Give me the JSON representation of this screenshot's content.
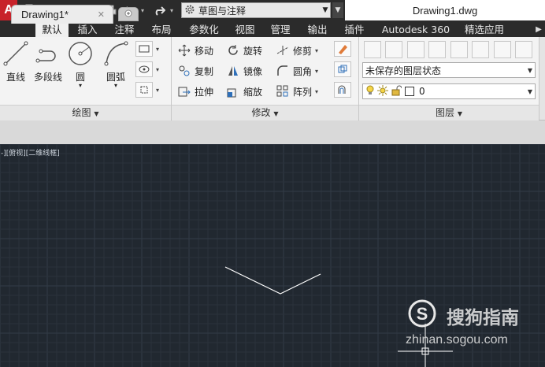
{
  "app": {
    "logo_letter": "A",
    "document_title": "Drawing1.dwg"
  },
  "qat": {
    "workspace": "草图与注释"
  },
  "ribbon_tabs": [
    "默认",
    "插入",
    "注释",
    "布局",
    "参数化",
    "视图",
    "管理",
    "输出",
    "插件",
    "Autodesk 360",
    "精选应用"
  ],
  "draw_panel": {
    "title": "绘图",
    "tools": [
      "直线",
      "多段线",
      "圆",
      "圆弧"
    ]
  },
  "modify_panel": {
    "title": "修改",
    "tools": [
      "移动",
      "旋转",
      "修剪",
      "复制",
      "镜像",
      "圆角",
      "拉伸",
      "缩放",
      "阵列"
    ]
  },
  "layers_panel": {
    "title": "图层",
    "layer_state": "未保存的图层状态",
    "current_layer": "0"
  },
  "doc_tab": {
    "name": "Drawing1*",
    "close": "✕"
  },
  "viewport": {
    "label": "-][俯视][二维线框]"
  },
  "watermark": {
    "brand": "搜狗指南",
    "url": "zhinan.sogou.com"
  },
  "colors": {
    "canvas": "#212830",
    "grid_minor": "#2a323b",
    "grid_major": "#323c47",
    "title_bar": "#2b2b2b",
    "app_red": "#c8222a"
  }
}
